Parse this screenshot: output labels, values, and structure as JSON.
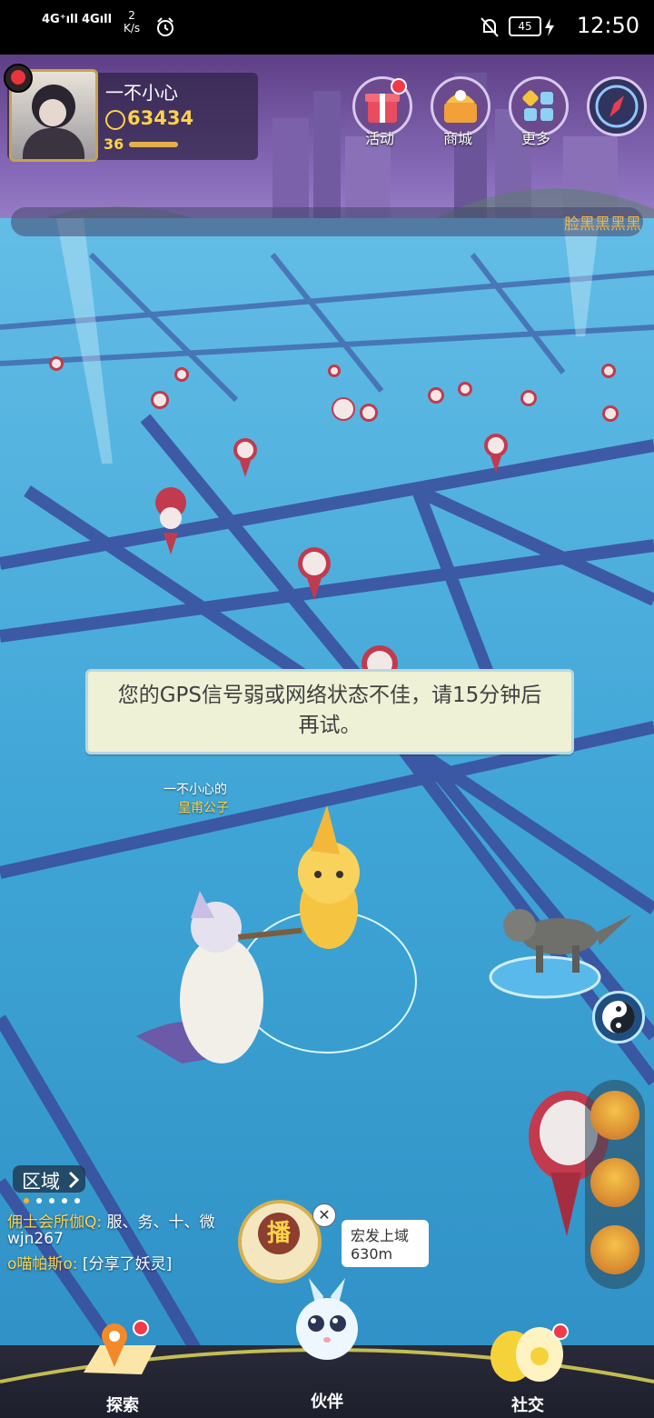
{
  "status_bar": {
    "signal1": "4G⁺ıll",
    "signal2": "4Gıll",
    "speed_value": "2",
    "speed_unit": "K/s",
    "battery": "45",
    "time": "12:50"
  },
  "profile": {
    "username": "一不小心",
    "coins": "63434",
    "level": "36"
  },
  "top_buttons": [
    {
      "label": "活动"
    },
    {
      "label": "商城"
    },
    {
      "label": "更多"
    }
  ],
  "marquee_text": "脸黑黑黑黑",
  "gps_dialog": {
    "line1": "您的GPS信号弱或网络状态不佳，请15分钟后",
    "line2": "再试。"
  },
  "player": {
    "owner_line": "一不小心的",
    "pet_name": "皇甫公子"
  },
  "region_button": "区域",
  "chat": [
    {
      "name": "佣士会所伽Q:",
      "text": " 服、务、十、微"
    },
    {
      "name": "",
      "text": "wjn267"
    },
    {
      "name": "o喵帕斯o:",
      "text": " [分享了妖灵]"
    }
  ],
  "broadcast": {
    "icon_char": "播",
    "location": "宏发上域",
    "distance": "630m"
  },
  "nav": {
    "explore": "探索",
    "partner": "伙伴",
    "social": "社交"
  },
  "colors": {
    "map": "#3fa5d6",
    "road": "#3a4b9c",
    "accent_gold": "#ffd24a",
    "alert_red": "#f03a4c"
  }
}
